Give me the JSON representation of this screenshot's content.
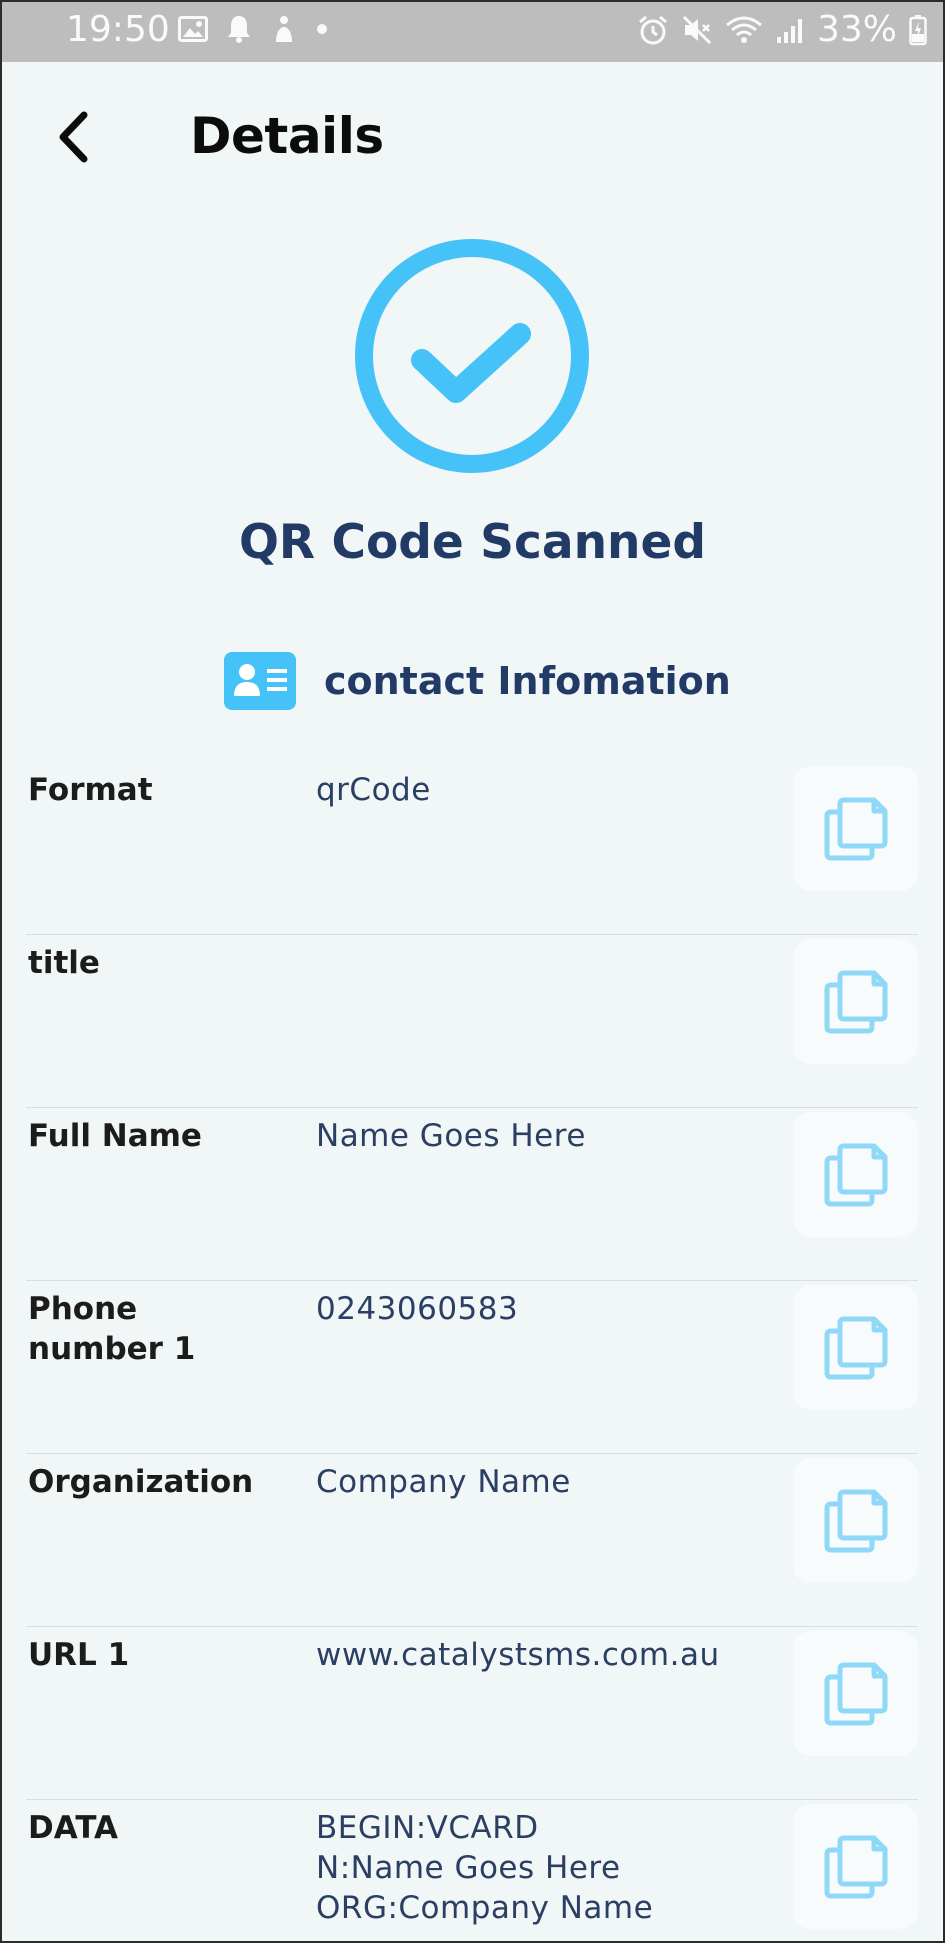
{
  "status_bar": {
    "time": "19:50",
    "battery": "33%",
    "left_icons": [
      "image-icon",
      "bell-icon",
      "gesture-icon",
      "dot-icon"
    ],
    "right_icons": [
      "alarm-icon",
      "mute-icon",
      "wifi-icon",
      "signal-icon",
      "battery-charging-icon"
    ]
  },
  "header": {
    "title": "Details",
    "back_icon": "chevron-left-icon"
  },
  "success": {
    "icon": "check-circle-icon",
    "title": "QR Code Scanned",
    "accent_color": "#45c2f7"
  },
  "section": {
    "icon": "contact-card-icon",
    "label": "contact Infomation"
  },
  "rows": [
    {
      "label": "Format",
      "value": "qrCode"
    },
    {
      "label": "title",
      "value": ""
    },
    {
      "label": "Full Name",
      "value": "Name Goes Here"
    },
    {
      "label": "Phone number 1",
      "value": "0243060583"
    },
    {
      "label": "Organization",
      "value": "Company Name"
    },
    {
      "label": "URL 1",
      "value": "www.catalystsms.com.au"
    },
    {
      "label": "DATA",
      "value": "BEGIN:VCARD\nN:Name Goes Here\nORG:Company Name"
    }
  ],
  "copy_icon": "copy-icon",
  "colors": {
    "background": "#f1f6f7",
    "text_dark_blue": "#223a66",
    "copy_icon": "#8fd8f7"
  }
}
